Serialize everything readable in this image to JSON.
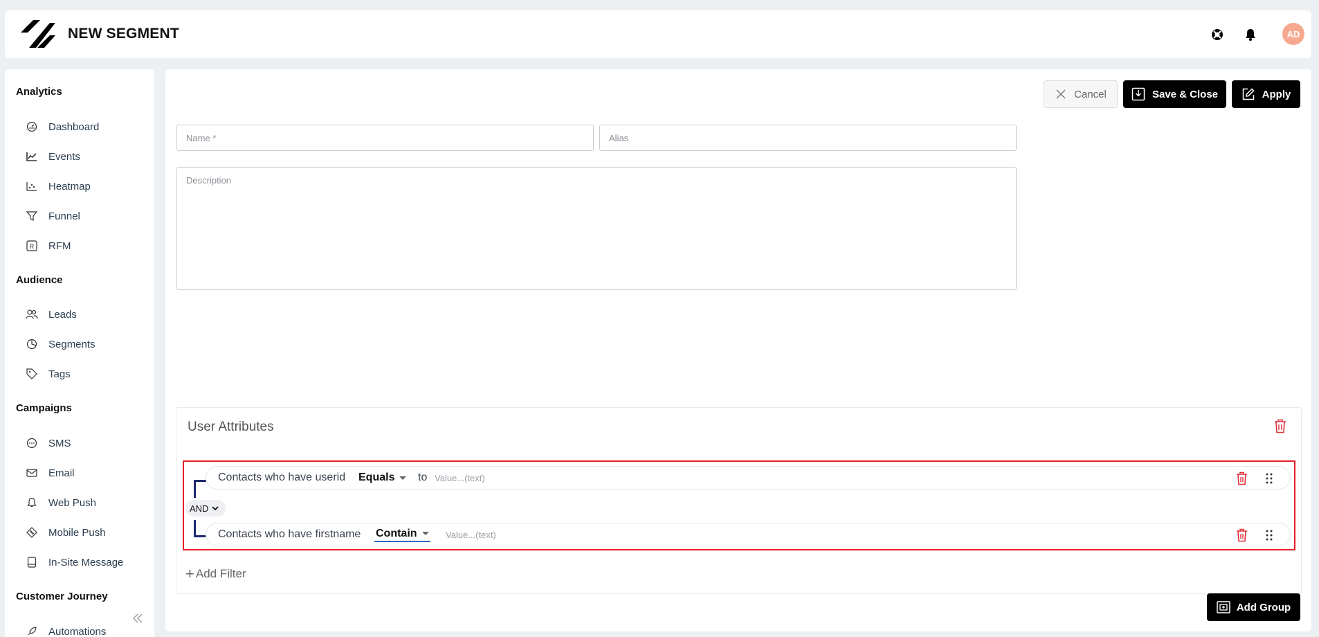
{
  "header": {
    "title": "NEW SEGMENT",
    "avatar_initials": "AD"
  },
  "sidebar": {
    "sections": [
      {
        "label": "Analytics",
        "items": [
          {
            "label": "Dashboard",
            "icon": "gauge-icon"
          },
          {
            "label": "Events",
            "icon": "line-chart-icon"
          },
          {
            "label": "Heatmap",
            "icon": "scatter-icon"
          },
          {
            "label": "Funnel",
            "icon": "funnel-icon"
          },
          {
            "label": "RFM",
            "icon": "r-box-icon"
          }
        ]
      },
      {
        "label": "Audience",
        "items": [
          {
            "label": "Leads",
            "icon": "users-icon"
          },
          {
            "label": "Segments",
            "icon": "pie-icon"
          },
          {
            "label": "Tags",
            "icon": "tag-icon"
          }
        ]
      },
      {
        "label": "Campaigns",
        "items": [
          {
            "label": "SMS",
            "icon": "chat-icon"
          },
          {
            "label": "Email",
            "icon": "mail-icon"
          },
          {
            "label": "Web Push",
            "icon": "bell-icon"
          },
          {
            "label": "Mobile Push",
            "icon": "mobile-push-icon"
          },
          {
            "label": "In-Site Message",
            "icon": "message-frame-icon"
          }
        ]
      },
      {
        "label": "Customer Journey",
        "items": [
          {
            "label": "Automations",
            "icon": "rocket-icon"
          }
        ]
      }
    ]
  },
  "toolbar": {
    "cancel_label": "Cancel",
    "save_label": "Save & Close",
    "apply_label": "Apply"
  },
  "form": {
    "name_placeholder": "Name *",
    "alias_placeholder": "Alias",
    "description_placeholder": "Description"
  },
  "filters": {
    "group_title": "User Attributes",
    "conditions": [
      {
        "text": "Contacts who have userid",
        "operator": "Equals",
        "connector": "to",
        "value_placeholder": "Value...(text)"
      },
      {
        "text": "Contacts who have firstname",
        "operator": "Contain",
        "connector": "",
        "value_placeholder": "Value...(text)"
      }
    ],
    "logic": "AND",
    "add_filter_label": "Add Filter",
    "add_group_label": "Add Group"
  },
  "colors": {
    "highlight": "#e41f26",
    "trash": "#e0303a",
    "bracket": "#1f2a6e",
    "avatar": "#f6a98f"
  }
}
